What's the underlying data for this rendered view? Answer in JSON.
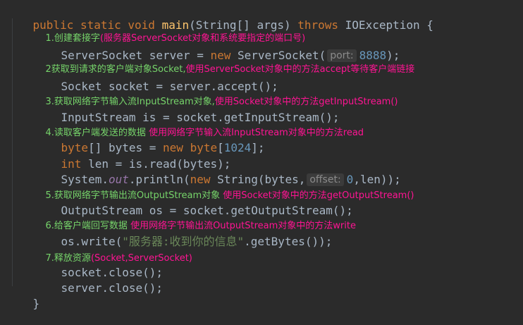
{
  "code": {
    "l1_kw1": "public",
    "l1_kw2": "static",
    "l1_kw3": "void",
    "l1_fn": "main",
    "l1_a": "(String[] args) ",
    "l1_kw4": "throws",
    "l1_b": " IOException {",
    "c1_g": "1.创建套接字",
    "c1_r": "(服务器ServerSocket对象和系统要指定的端口号)",
    "l2_a": "ServerSocket server = ",
    "l2_kw": "new",
    "l2_b": " ServerSocket(",
    "l2_hint": "port:",
    "l2_num": "8888",
    "l2_c": ");",
    "c2_g": "2获取到请求的客户端对象Socket,",
    "c2_r": "使用ServerSocket对象中的方法accept等待客户端链接",
    "l3": "Socket socket = server.accept();",
    "c3_g": "3.获取网络字节输入流InputStream对象,",
    "c3_r": "使用Socket对象中的方法getInputStream()",
    "l4": "InputStream is = socket.getInputStream();",
    "c4_g": "4.读取客户端发送的数据 ",
    "c4_r": "使用网络字节输入流InputStream对象中的方法read",
    "l5_a": "byte",
    "l5_b": "[] bytes = ",
    "l5_kw": "new",
    "l5_c": " ",
    "l5_kw2": "byte",
    "l5_d": "[",
    "l5_num": "1024",
    "l5_e": "];",
    "l6_kw": "int",
    "l6_a": " len = is.read(bytes);",
    "l7_a": "System.",
    "l7_fld": "out",
    "l7_b": ".println(",
    "l7_kw": "new",
    "l7_c": " String(bytes,",
    "l7_hint": "offset:",
    "l7_num": "0",
    "l7_d": ",len));",
    "c5_g": "5.获取网络字节输出流OutputStream对象 ",
    "c5_r": "使用Socket对象中的方法getOutputStream()",
    "l8": "OutputStream os = socket.getOutputStream();",
    "c6_g": "6.给客户端回写数据 ",
    "c6_r": "使用网络字节输出流OutputStream对象中的方法write",
    "l9_a": "os.write(",
    "l9_str": "\"服务器:收到你的信息\"",
    "l9_b": ".getBytes());",
    "c7_g": "7.释放资源",
    "c7_r": "(Socket,ServerSocket)",
    "l10": "socket.close();",
    "l11": "server.close();",
    "l12": "}"
  }
}
